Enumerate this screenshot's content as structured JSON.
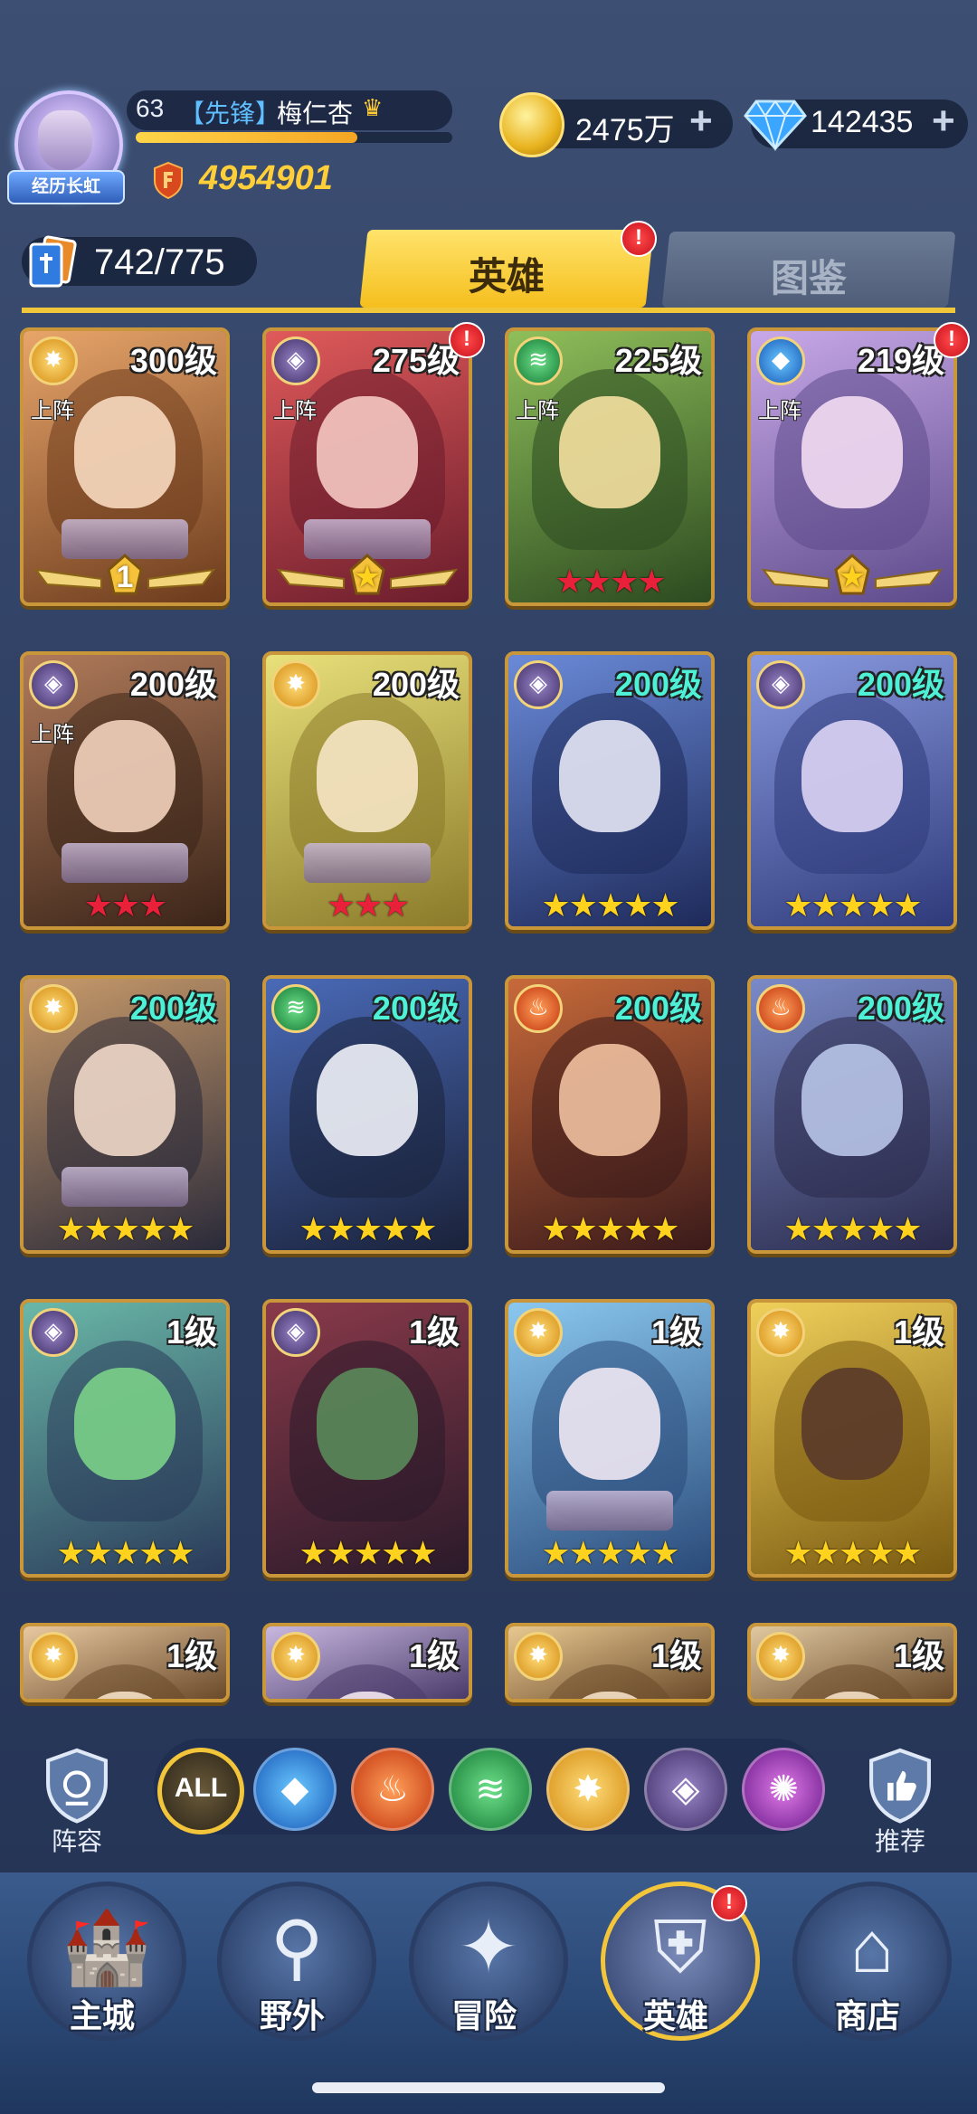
{
  "player": {
    "avatar_title": "经历长虹",
    "level": "63",
    "tag": "【先锋】",
    "name": "梅仁杏",
    "exp_fraction": 0.7,
    "power": "4954901"
  },
  "currency": {
    "gold": "2475万",
    "gems": "142435",
    "plus": "+"
  },
  "hero_count": "742/775",
  "tabs": {
    "heroes": "英雄",
    "codex": "图鉴",
    "alert": "!"
  },
  "colors": {
    "accent_gold": "#f5bf1e",
    "level_white": "#ffffff",
    "level_cyan": "#4ef0d6",
    "star_red": "#e8203a",
    "star_gold": "#ffd21e",
    "alert_red": "#d8141e"
  },
  "heroes": [
    {
      "level": "300级",
      "element": "light",
      "deployed": "上阵",
      "stars_type": "medal",
      "medal_text": "1",
      "alert": false,
      "level_color": "white"
    },
    {
      "level": "275级",
      "element": "dark",
      "deployed": "上阵",
      "stars_type": "medal-star",
      "medal_text": "★",
      "alert": true,
      "level_color": "white"
    },
    {
      "level": "225级",
      "element": "wind",
      "deployed": "上阵",
      "stars_type": "red",
      "stars": "★★★★",
      "alert": false,
      "level_color": "white"
    },
    {
      "level": "219级",
      "element": "water",
      "deployed": "上阵",
      "stars_type": "medal-star",
      "medal_text": "★",
      "alert": true,
      "level_color": "white"
    },
    {
      "level": "200级",
      "element": "dark",
      "deployed": "上阵",
      "stars_type": "red",
      "stars": "★★★",
      "alert": false,
      "level_color": "white"
    },
    {
      "level": "200级",
      "element": "light",
      "deployed": "",
      "stars_type": "red",
      "stars": "★★★",
      "alert": false,
      "level_color": "white"
    },
    {
      "level": "200级",
      "element": "dark",
      "deployed": "",
      "stars_type": "gold",
      "stars": "★★★★★",
      "alert": false,
      "level_color": "cyan"
    },
    {
      "level": "200级",
      "element": "dark",
      "deployed": "",
      "stars_type": "gold",
      "stars": "★★★★★",
      "alert": false,
      "level_color": "cyan"
    },
    {
      "level": "200级",
      "element": "light",
      "deployed": "",
      "stars_type": "gold",
      "stars": "★★★★★",
      "alert": false,
      "level_color": "cyan"
    },
    {
      "level": "200级",
      "element": "wind",
      "deployed": "",
      "stars_type": "gold",
      "stars": "★★★★★",
      "alert": false,
      "level_color": "cyan"
    },
    {
      "level": "200级",
      "element": "fire",
      "deployed": "",
      "stars_type": "gold",
      "stars": "★★★★★",
      "alert": false,
      "level_color": "cyan"
    },
    {
      "level": "200级",
      "element": "fire",
      "deployed": "",
      "stars_type": "gold",
      "stars": "★★★★★",
      "alert": false,
      "level_color": "cyan"
    },
    {
      "level": "1级",
      "element": "dark",
      "deployed": "",
      "stars_type": "gold",
      "stars": "★★★★★",
      "alert": false,
      "level_color": "white"
    },
    {
      "level": "1级",
      "element": "dark",
      "deployed": "",
      "stars_type": "gold",
      "stars": "★★★★★",
      "alert": false,
      "level_color": "white"
    },
    {
      "level": "1级",
      "element": "light",
      "deployed": "",
      "stars_type": "gold",
      "stars": "★★★★★",
      "alert": false,
      "level_color": "white"
    },
    {
      "level": "1级",
      "element": "light",
      "deployed": "",
      "stars_type": "gold",
      "stars": "★★★★★",
      "alert": false,
      "level_color": "white"
    },
    {
      "level": "1级",
      "element": "light",
      "deployed": "",
      "stars_type": "none",
      "alert": false,
      "level_color": "white"
    },
    {
      "level": "1级",
      "element": "light",
      "deployed": "",
      "stars_type": "none",
      "alert": false,
      "level_color": "white"
    },
    {
      "level": "1级",
      "element": "light",
      "deployed": "",
      "stars_type": "none",
      "alert": false,
      "level_color": "white"
    },
    {
      "level": "1级",
      "element": "light",
      "deployed": "",
      "stars_type": "none",
      "alert": false,
      "level_color": "white"
    }
  ],
  "filters": {
    "lineup": "阵容",
    "recommend": "推荐",
    "items": [
      {
        "name": "all",
        "label": "ALL"
      },
      {
        "name": "water"
      },
      {
        "name": "fire"
      },
      {
        "name": "wind"
      },
      {
        "name": "light"
      },
      {
        "name": "dark"
      },
      {
        "name": "chaos"
      }
    ]
  },
  "nav": {
    "items": [
      {
        "name": "main-city",
        "label": "主城"
      },
      {
        "name": "field",
        "label": "野外"
      },
      {
        "name": "adventure",
        "label": "冒险"
      },
      {
        "name": "heroes",
        "label": "英雄",
        "alert": "!"
      },
      {
        "name": "shop",
        "label": "商店"
      }
    ]
  }
}
